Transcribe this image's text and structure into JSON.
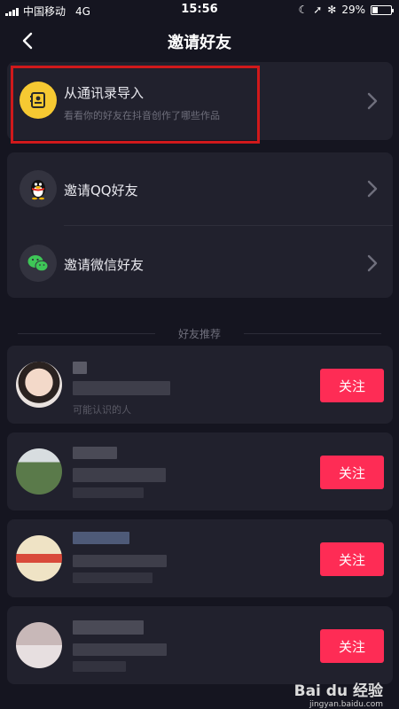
{
  "status": {
    "carrier": "中国移动",
    "network": "4G",
    "time": "15:56",
    "battery": "29%",
    "battery_level": 0.29
  },
  "header": {
    "title": "邀请好友"
  },
  "contacts": {
    "label": "从通讯录导入",
    "sub": "看看你的好友在抖音创作了哪些作品"
  },
  "invite": {
    "qq": "邀请QQ好友",
    "wechat": "邀请微信好友"
  },
  "section": {
    "title": "好友推荐"
  },
  "recommend": {
    "follow": "关注",
    "items": [
      {
        "sub": "可能认识的人"
      },
      {
        "sub": ""
      },
      {
        "sub": ""
      },
      {
        "sub": ""
      }
    ]
  },
  "watermark": {
    "brand": "Bai du 经验",
    "url": "jingyan.baidu.com"
  },
  "colors": {
    "background": "#151520",
    "card": "#21212d",
    "accent": "#fe2c55",
    "highlight": "#d0191b",
    "contacts_icon": "#f6c932",
    "wechat_icon": "#3ec657"
  },
  "icons": {
    "back": "chevron-left-icon",
    "contacts": "contact-book-icon",
    "qq": "qq-penguin-icon",
    "wechat": "wechat-icon",
    "chevron": "chevron-right-icon"
  }
}
